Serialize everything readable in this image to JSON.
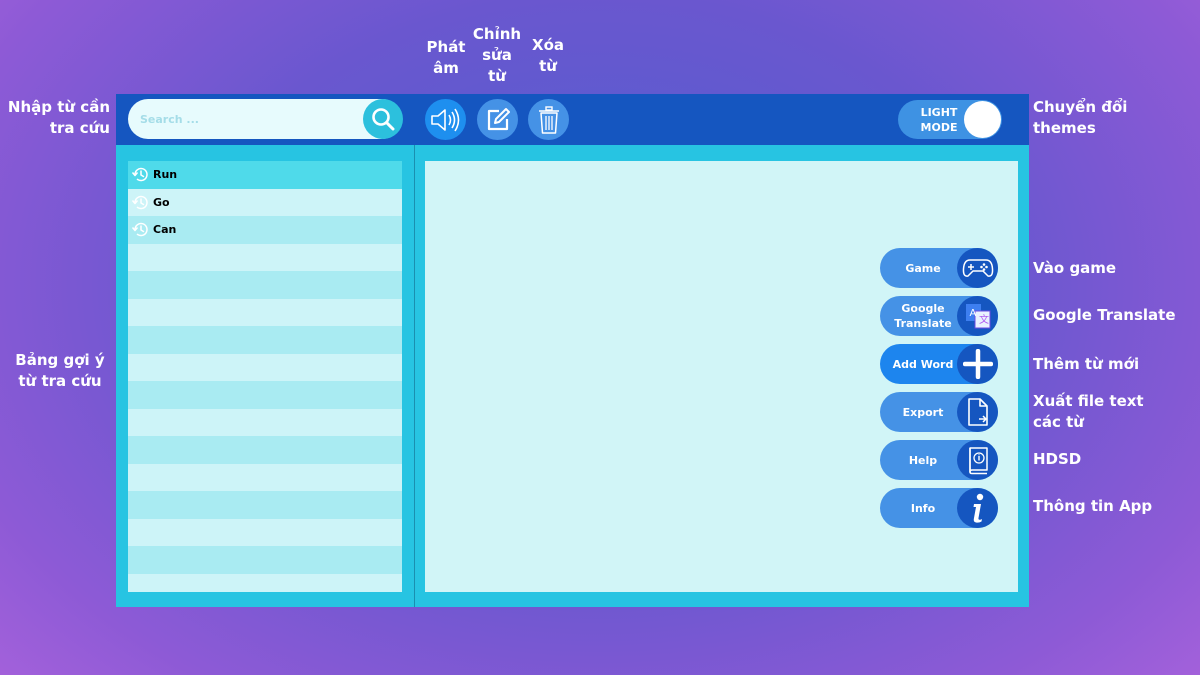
{
  "annotations": {
    "pronounce": [
      "Phát",
      "âm"
    ],
    "edit": [
      "Chỉnh",
      "sửa",
      "từ"
    ],
    "delete": [
      "Xóa",
      "từ"
    ],
    "search": [
      "Nhập từ cần",
      "tra cứu"
    ],
    "theme": [
      "Chuyển đổi",
      "themes"
    ],
    "suggest": [
      "Bảng gợi ý",
      "từ tra cứu"
    ],
    "game": "Vào game",
    "google_translate": "Google Translate",
    "add_word": "Thêm từ mới",
    "export": [
      "Xuất file text",
      "các từ"
    ],
    "help": "HDSD",
    "info": "Thông tin App"
  },
  "search": {
    "placeholder": "Search ..."
  },
  "theme_toggle": {
    "label": "LIGHT\nMODE"
  },
  "suggestions": {
    "items": [
      "Run",
      "Go",
      "Can"
    ]
  },
  "side_buttons": {
    "game": "Game",
    "google_translate": "Google\nTranslate",
    "add_word": "Add Word",
    "export": "Export",
    "help": "Help",
    "info": "Info"
  },
  "colors": {
    "topbar": "#1556c0",
    "app_bg": "#27c4e2",
    "panel_bg": "#d1f5f7",
    "button": "#4592e6",
    "active_row": "#4fdaea"
  },
  "icons": {
    "search": "search-icon",
    "speaker": "speaker-icon",
    "edit": "edit-icon",
    "trash": "trash-icon",
    "history": "history-icon",
    "game": "gamepad-icon",
    "translate": "translate-icon",
    "add": "plus-icon",
    "export": "file-export-icon",
    "help": "book-icon",
    "info": "info-icon"
  }
}
